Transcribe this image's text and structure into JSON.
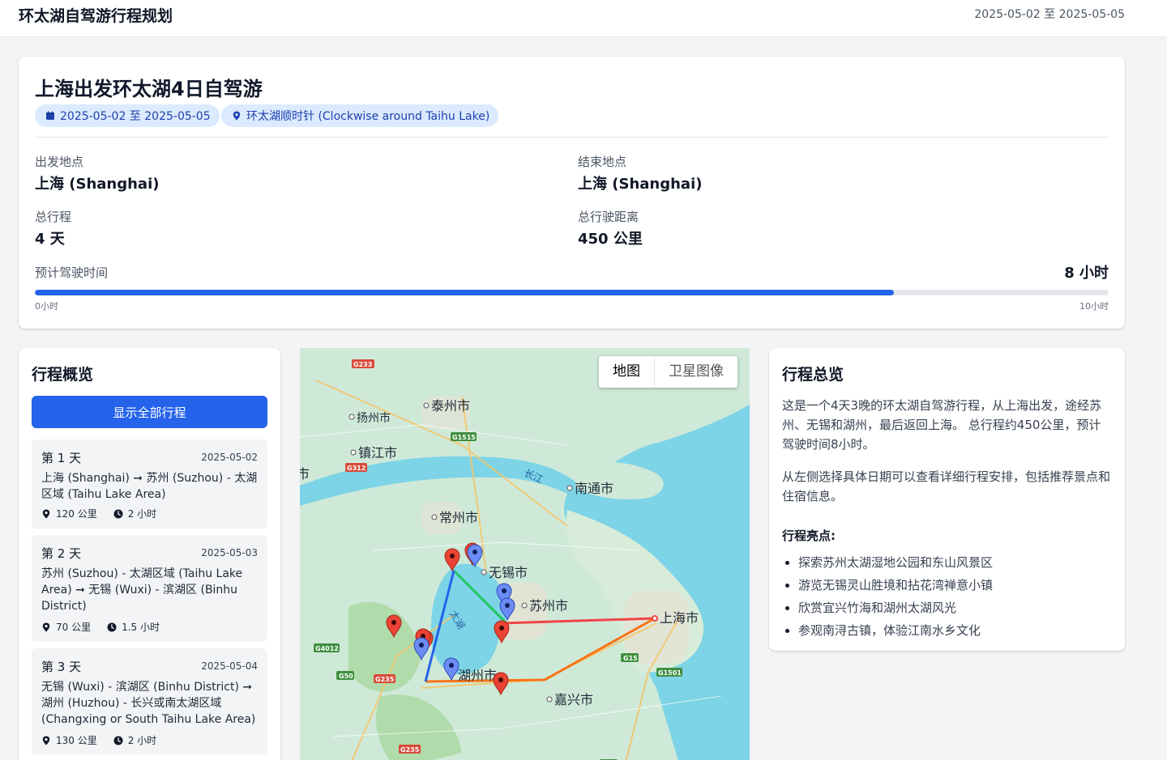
{
  "header": {
    "title": "环太湖自驾游行程规划",
    "date_range": "2025-05-02 至 2025-05-05"
  },
  "summary": {
    "title": "上海出发环太湖4日自驾游",
    "date_pill": "2025-05-02 至 2025-05-05",
    "route_pill": "环太湖顺时针 (Clockwise around Taihu Lake)",
    "start_label": "出发地点",
    "start_value": "上海 (Shanghai)",
    "end_label": "结束地点",
    "end_value": "上海 (Shanghai)",
    "duration_label": "总行程",
    "duration_value": "4 天",
    "distance_label": "总行驶距离",
    "distance_value": "450 公里",
    "drive_label": "预计驾驶时间",
    "drive_value": "8 小时",
    "drive_hours": 8,
    "drive_max_hours": 10,
    "progress_min_label": "0小时",
    "progress_max_label": "10小时"
  },
  "itinerary": {
    "heading": "行程概览",
    "show_all_label": "显示全部行程",
    "days": [
      {
        "title": "第 1 天",
        "date": "2025-05-02",
        "route": "上海 (Shanghai) ➞ 苏州 (Suzhou) - 太湖区域 (Taihu Lake Area)",
        "distance": "120 公里",
        "time": "2 小时"
      },
      {
        "title": "第 2 天",
        "date": "2025-05-03",
        "route": "苏州 (Suzhou) - 太湖区域 (Taihu Lake Area) ➞ 无锡 (Wuxi) - 滨湖区 (Binhu District)",
        "distance": "70 公里",
        "time": "1.5 小时"
      },
      {
        "title": "第 3 天",
        "date": "2025-05-04",
        "route": "无锡 (Wuxi) - 滨湖区 (Binhu District) ➞ 湖州 (Huzhou) - 长兴或南太湖区域 (Changxing or South Taihu Lake Area)",
        "distance": "130 公里",
        "time": "2 小时"
      }
    ]
  },
  "map": {
    "toggle_map": "地图",
    "toggle_satellite": "卫星图像",
    "cities": [
      "泰州市",
      "扬州市",
      "镇江市",
      "南通市",
      "常州市",
      "无锡市",
      "苏州市",
      "上海市",
      "湖州市",
      "嘉兴市"
    ],
    "lake_label": "太湖",
    "river_label": "长江",
    "road_shields": [
      "G233",
      "G1515",
      "G312",
      "G4012",
      "G50",
      "G235",
      "G15",
      "G1501",
      "G235",
      "G15"
    ],
    "colors": {
      "water": "#7dd4e6",
      "land": "#cfe9d8",
      "route_day1": "#ef4444",
      "route_day2": "#22c55e",
      "route_day3": "#f97316",
      "route_day4": "#2563eb"
    }
  },
  "overview": {
    "heading": "行程总览",
    "para1": "这是一个4天3晚的环太湖自驾游行程，从上海出发，途经苏州、无锡和湖州，最后返回上海。 总行程约450公里，预计驾驶时间8小时。",
    "para2": "从左侧选择具体日期可以查看详细行程安排，包括推荐景点和住宿信息。",
    "highlights_title": "行程亮点:",
    "highlights": [
      "探索苏州太湖湿地公园和东山风景区",
      "游览无锡灵山胜境和拈花湾禅意小镇",
      "欣赏宜兴竹海和湖州太湖风光",
      "参观南浔古镇，体验江南水乡文化"
    ]
  }
}
